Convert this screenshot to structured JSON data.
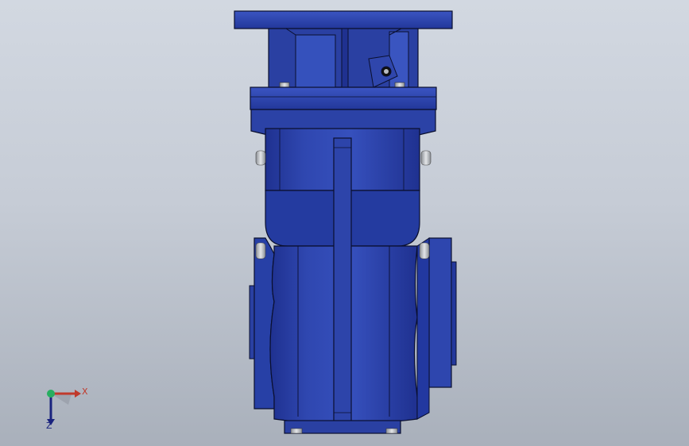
{
  "viewport": {
    "background_top": "#d2d8e1",
    "background_bottom": "#a9b0bb"
  },
  "model": {
    "name": "gearbox-housing-assembly",
    "body_color": "#2d44a8",
    "body_dark": "#1c2d7e",
    "body_light": "#3f59c4",
    "outline_color": "#0a0f2e",
    "bolt_color": "#b9bcc2"
  },
  "triad": {
    "x_label": "X",
    "z_label": "Z",
    "x_color": "#c0392b",
    "y_color": "#27ae60",
    "z_color": "#1a237e"
  }
}
